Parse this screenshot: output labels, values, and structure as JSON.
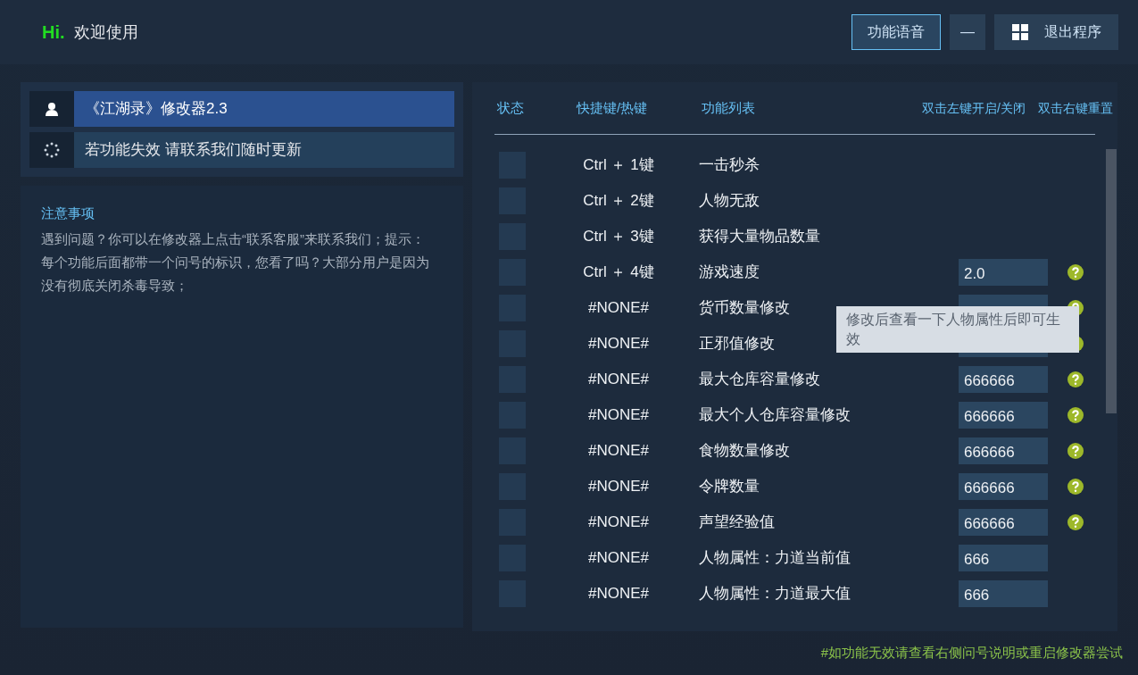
{
  "header": {
    "logo": "Hi.",
    "title": "欢迎使用",
    "buttons": [
      {
        "kind": "text",
        "label": "功能语音",
        "selected": true
      },
      {
        "kind": "minimize",
        "label": "—",
        "selected": false
      },
      {
        "kind": "exit",
        "label": "退出程序",
        "selected": false
      }
    ]
  },
  "sidebar": {
    "items": [
      {
        "kind": "user",
        "label": "《江湖录》修改器2.3",
        "selected": true
      },
      {
        "kind": "loading",
        "label": "若功能失效  请联系我们随时更新",
        "selected": false
      }
    ]
  },
  "notice": {
    "title": "注意事项",
    "text": "遇到问题？你可以在修改器上点击“联系客服”来联系我们；提示：每个功能后面都带一个问号的标识，您看了吗？大部分用户是因为没有彻底关闭杀毒导致；"
  },
  "table": {
    "columns": [
      "状态",
      "快捷键/热键",
      "功能列表"
    ],
    "actions": [
      "双击左键开启/关闭",
      "双击右键重置"
    ],
    "rows": [
      {
        "kind": "plain",
        "checked": false,
        "hotkey": "Ctrl ＋ 1键",
        "name": "一击秒杀",
        "help": false
      },
      {
        "kind": "plain",
        "checked": false,
        "hotkey": "Ctrl ＋ 2键",
        "name": "人物无敌",
        "help": false
      },
      {
        "kind": "plain",
        "checked": false,
        "hotkey": "Ctrl ＋ 3键",
        "name": "获得大量物品数量",
        "help": false
      },
      {
        "kind": "input",
        "checked": false,
        "hotkey": "Ctrl ＋ 4键",
        "name": "游戏速度",
        "value": "2.0",
        "help": true
      },
      {
        "kind": "input",
        "checked": false,
        "hotkey": "#NONE#",
        "name": "货币数量修改",
        "help": true
      },
      {
        "kind": "input",
        "checked": false,
        "hotkey": "#NONE#",
        "name": "正邪值修改",
        "help": true
      },
      {
        "kind": "input",
        "checked": false,
        "hotkey": "#NONE#",
        "name": "最大仓库容量修改",
        "value": "666666",
        "help": true
      },
      {
        "kind": "input",
        "checked": false,
        "hotkey": "#NONE#",
        "name": "最大个人仓库容量修改",
        "value": "666666",
        "help": true
      },
      {
        "kind": "input",
        "checked": false,
        "hotkey": "#NONE#",
        "name": "食物数量修改",
        "value": "666666",
        "help": true
      },
      {
        "kind": "input",
        "checked": false,
        "hotkey": "#NONE#",
        "name": "令牌数量",
        "value": "666666",
        "help": true
      },
      {
        "kind": "input",
        "checked": false,
        "hotkey": "#NONE#",
        "name": "声望经验值",
        "value": "666666",
        "help": true
      },
      {
        "kind": "input",
        "checked": false,
        "hotkey": "#NONE#",
        "name": "人物属性：力道当前值",
        "value": "666",
        "help": false
      },
      {
        "kind": "input",
        "checked": false,
        "hotkey": "#NONE#",
        "name": "人物属性：力道最大值",
        "value": "666",
        "help": false
      }
    ]
  },
  "tooltip": "修改后查看一下人物属性后即可生效",
  "footer": "#如功能无效请查看右侧问号说明或重启修改器尝试"
}
